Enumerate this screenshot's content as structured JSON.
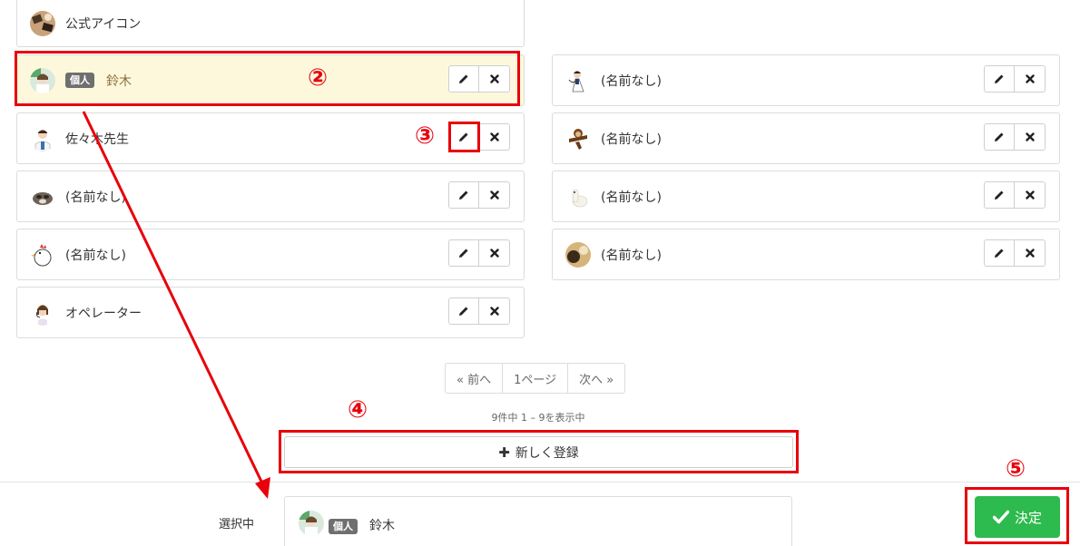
{
  "colors": {
    "accent_red": "#e8000b",
    "confirm_green": "#2dba4e",
    "selected_bg": "#fdf8dc"
  },
  "partial_top": {
    "name": "公式アイコン",
    "icon": "official-avatar"
  },
  "left_cards": [
    {
      "name": "鈴木",
      "badge": "個人",
      "icon": "nurse-avatar",
      "selected": true
    },
    {
      "name": "佐々木先生",
      "icon": "doctor-avatar"
    },
    {
      "name": "(名前なし)",
      "icon": "raccoon-avatar"
    },
    {
      "name": "(名前なし)",
      "icon": "chicken-avatar"
    },
    {
      "name": "オペレーター",
      "icon": "operator-avatar"
    }
  ],
  "right_cards": [
    {
      "name": "(名前なし)",
      "icon": "waiter-avatar"
    },
    {
      "name": "(名前なし)",
      "icon": "monkey-avatar"
    },
    {
      "name": "(名前なし)",
      "icon": "alpaca-avatar"
    },
    {
      "name": "(名前なし)",
      "icon": "photo-avatar"
    }
  ],
  "actions": {
    "edit_icon": "pencil-icon",
    "delete_icon": "close-icon"
  },
  "pagination": {
    "prev": "« 前へ",
    "current": "1ページ",
    "next": "次へ »"
  },
  "count_text": "9件中 1 – 9を表示中",
  "new_button": {
    "icon": "plus-icon",
    "label": "新しく登録"
  },
  "selected": {
    "label": "選択中",
    "badge": "個人",
    "name": "鈴木"
  },
  "confirm_button": {
    "icon": "check-icon",
    "label": "決定"
  },
  "annotations": [
    "②",
    "③",
    "④",
    "⑤"
  ]
}
